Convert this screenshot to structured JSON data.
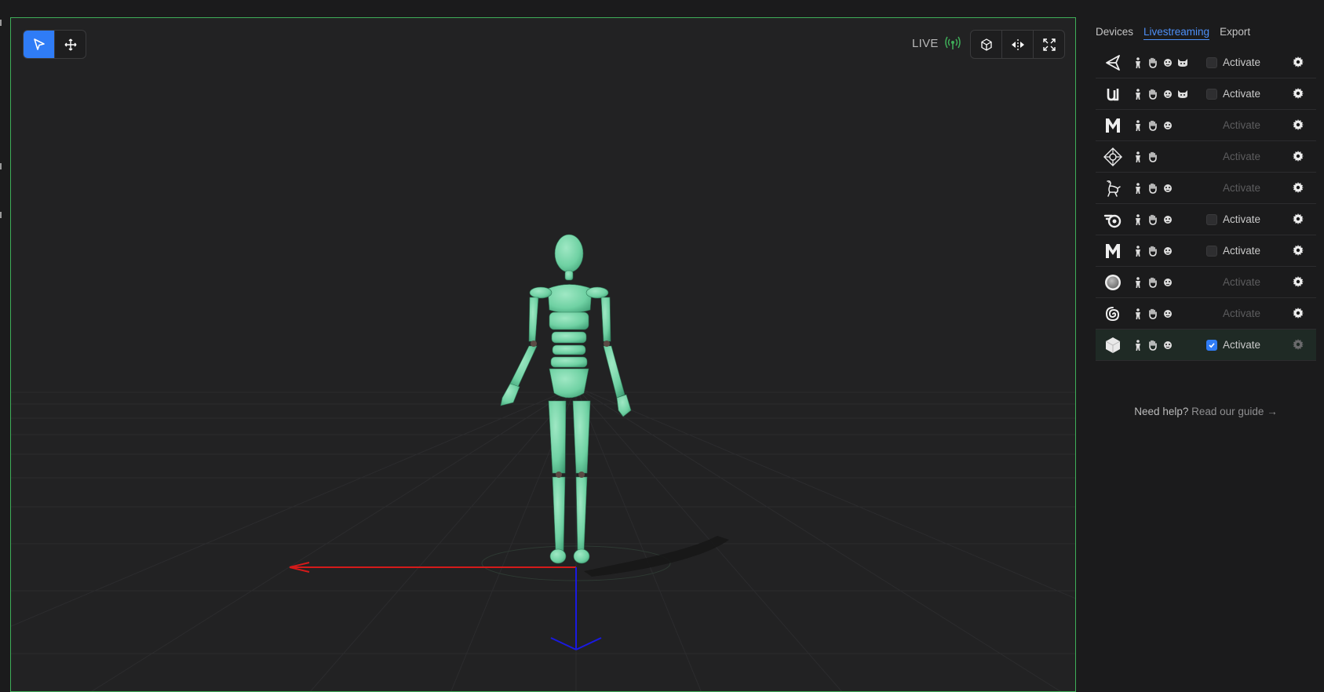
{
  "viewport": {
    "live_label": "LIVE",
    "accent_color": "#3fae59",
    "tools": [
      {
        "name": "select",
        "icon": "pointer-icon",
        "active": true
      },
      {
        "name": "move",
        "icon": "move-icon",
        "active": false
      }
    ],
    "view_buttons": [
      {
        "name": "cube-view",
        "icon": "cube-icon"
      },
      {
        "name": "mirror",
        "icon": "mirror-icon"
      },
      {
        "name": "fullscreen",
        "icon": "fullscreen-icon"
      }
    ]
  },
  "panel": {
    "tabs": [
      {
        "label": "Devices",
        "active": false
      },
      {
        "label": "Livestreaming",
        "active": true
      },
      {
        "label": "Export",
        "active": false
      }
    ],
    "integrations": [
      {
        "icon": "unity-icon",
        "caps": [
          "body-icon",
          "hand-icon",
          "face-icon",
          "cat-icon"
        ],
        "activate_label": "Activate",
        "checkbox": "unchecked"
      },
      {
        "icon": "unreal-icon",
        "caps": [
          "body-icon",
          "hand-icon",
          "face-icon",
          "cat-icon"
        ],
        "activate_label": "Activate",
        "checkbox": "unchecked"
      },
      {
        "icon": "maya-icon",
        "caps": [
          "body-icon",
          "hand-icon",
          "face-icon"
        ],
        "activate_label": "Activate",
        "checkbox": "none"
      },
      {
        "icon": "motionbuilder-icon",
        "caps": [
          "body-icon",
          "hand-icon"
        ],
        "activate_label": "Activate",
        "checkbox": "none"
      },
      {
        "icon": "character-icon",
        "caps": [
          "body-icon",
          "hand-icon",
          "face-icon"
        ],
        "activate_label": "Activate",
        "checkbox": "none"
      },
      {
        "icon": "blender-icon",
        "caps": [
          "body-icon",
          "hand-icon",
          "face-icon"
        ],
        "activate_label": "Activate",
        "checkbox": "unchecked"
      },
      {
        "icon": "maya-plugin-icon",
        "caps": [
          "body-icon",
          "hand-icon",
          "face-icon"
        ],
        "activate_label": "Activate",
        "checkbox": "unchecked"
      },
      {
        "icon": "sphere-icon",
        "caps": [
          "body-icon",
          "hand-icon",
          "face-icon"
        ],
        "activate_label": "Activate",
        "checkbox": "none"
      },
      {
        "icon": "houdini-icon",
        "caps": [
          "body-icon",
          "hand-icon",
          "face-icon"
        ],
        "activate_label": "Activate",
        "checkbox": "none"
      },
      {
        "icon": "cube-app-icon",
        "caps": [
          "body-icon",
          "hand-icon",
          "face-icon"
        ],
        "activate_label": "Activate",
        "checkbox": "checked"
      }
    ],
    "help_prefix": "Need help?",
    "help_link": "Read our guide →"
  },
  "colors": {
    "selected_blue": "#2f7cf6",
    "figure_green": "#6fd1a3",
    "x_axis": "#d41a1a",
    "z_axis": "#1a1ae0"
  }
}
